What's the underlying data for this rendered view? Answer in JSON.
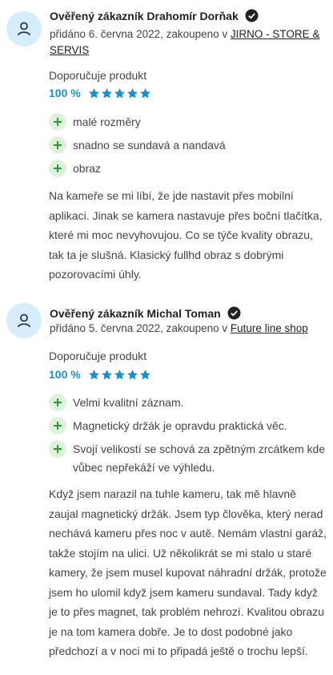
{
  "reviews": [
    {
      "author": "Ověřený zákazník Drahomír Dorňak",
      "meta_prefix": "přidáno 6. června 2022, zakoupeno v ",
      "shop": "JIRNO - STORE & SERVIS",
      "recommend": "Doporučuje produkt",
      "score": "100 %",
      "rating": 5,
      "pros": [
        "malé rozměry",
        "snadno se sundavá a nandavá",
        "obraz"
      ],
      "text": "Na kameře se mi líbí, že jde nastavit přes mobilní aplikaci. Jinak se kamera nastavuje přes boční tlačítka, které mi moc nevyhovujou. Co se týče kvality obrazu, tak ta je slušná. Klasický fullhd obraz s dobrými pozorovacími úhly."
    },
    {
      "author": "Ověřený zákazník Michal Toman",
      "meta_prefix": "přidáno 5. června 2022, zakoupeno v ",
      "shop": "Future line shop",
      "recommend": "Doporučuje produkt",
      "score": "100 %",
      "rating": 5,
      "pros": [
        "Velmi kvalitní záznam.",
        "Magnetický držák je opravdu praktická věc.",
        "Svojí velikostí se schová za zpětným zrcátkem kde vůbec nepřekáží ve výhledu."
      ],
      "text": "Když jsem narazil na tuhle kameru, tak mě hlavně zaujal magnetický držák. Jsem typ člověka, který nerad nechává kameru přes noc v autě. Nemám vlastní garáž, takže stojím na ulici. Už několikrát se mi stalo u staré kamery, že jsem musel kupovat náhradní držák, protože jsem ho ulomil když jsem kameru sundaval. Tady když je to přes magnet, tak problém nehrozí. Kvalitou obrazu je na tom kamera dobře. Je to dost podobné jako předchozí a v noci mi to připadá ještě o trochu lepší."
    }
  ],
  "colors": {
    "accent": "#1a8fc9",
    "star": "#1a8fc9",
    "plus_bg": "#dff3dc",
    "plus_fg": "#2e9a3a",
    "avatar_bg": "#d6eefb"
  },
  "icons": {
    "avatar": "user-icon",
    "verified": "check-badge-icon",
    "star": "star-icon",
    "plus": "plus-icon"
  }
}
